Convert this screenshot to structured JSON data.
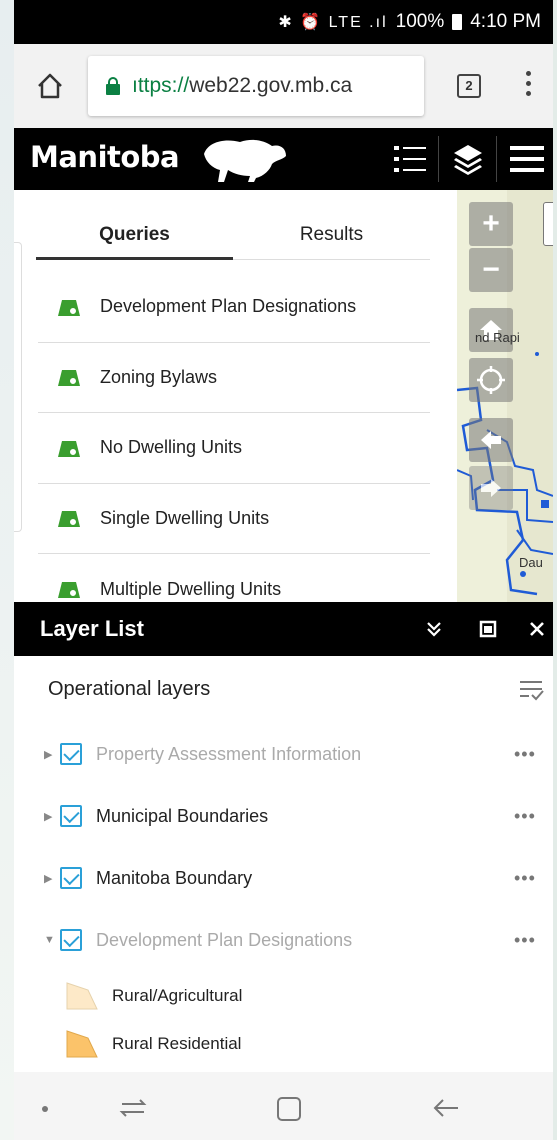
{
  "statusbar": {
    "icons": "✱ ⏰ LTE .ıl",
    "battery": "100%",
    "time": "4:10 PM"
  },
  "browser": {
    "url_proto": "ıttps://",
    "url_host": "web22.gov.mb.ca",
    "tab_count": "2"
  },
  "header": {
    "logo": "Manitoba",
    "icons": [
      "list-icon",
      "layers-icon",
      "hamburger-menu-icon"
    ]
  },
  "queries": {
    "tabs": [
      "Queries",
      "Results"
    ],
    "active_tab": "Queries",
    "items": [
      "Development Plan Designations",
      "Zoning Bylaws",
      "No Dwelling Units",
      "Single Dwelling Units",
      "Multiple Dwelling Units"
    ]
  },
  "map": {
    "label1": "nd Rapi",
    "label2": "Dau"
  },
  "layer_list": {
    "title": "Layer List",
    "section": "Operational layers",
    "layers": [
      {
        "name": "Property Assessment Information",
        "checked": true,
        "dimmed": true,
        "expanded": false
      },
      {
        "name": "Municipal Boundaries",
        "checked": true,
        "dimmed": false,
        "expanded": false
      },
      {
        "name": "Manitoba Boundary",
        "checked": true,
        "dimmed": false,
        "expanded": false
      },
      {
        "name": "Development Plan Designations",
        "checked": true,
        "dimmed": true,
        "expanded": true
      }
    ],
    "more_label": "•••",
    "legend": [
      {
        "label": "Rural/Agricultural",
        "color": "#fde9c8"
      },
      {
        "label": "Rural Residential",
        "color": "#fbc36a"
      }
    ]
  },
  "colors": {
    "accent": "#2aa0d8",
    "query_icon": "#3a9e2f",
    "header_bg": "#000000"
  }
}
